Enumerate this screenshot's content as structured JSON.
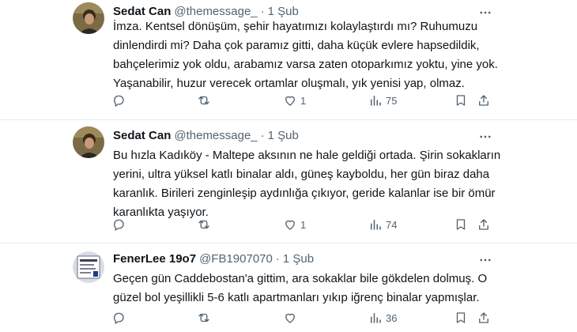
{
  "tweets": [
    {
      "name": "Sedat Can",
      "handle": "@themessage_",
      "separator": "·",
      "date": "1 Şub",
      "lines": [
        "İmza. Kentsel dönüşüm, şehir hayatımızı kolaylaştırdı mı? Ruhumuzu",
        "dinlendirdi mi? Daha çok paramız gitti, daha küçük evlere hapsedildik,",
        "bahçelerimiz yok oldu, arabamız varsa zaten otoparkımız yoktu, yine yok.",
        "Yaşanabilir, huzur verecek ortamlar oluşmalı, yık yenisi yap, olmaz."
      ],
      "replies": "",
      "retweets": "",
      "likes": "1",
      "views": "75"
    },
    {
      "name": "Sedat Can",
      "handle": "@themessage_",
      "separator": "·",
      "date": "1 Şub",
      "lines": [
        "Bu hızla Kadıköy - Maltepe aksının ne hale geldiği ortada. Şirin sokakların",
        "yerini, ultra yüksel katlı binalar aldı, güneş kayboldu, her gün biraz daha",
        "karanlık. Birileri zenginleşip aydınlığa çıkıyor, geride kalanlar ise bir ömür",
        "karanlıkta yaşıyor."
      ],
      "replies": "",
      "retweets": "",
      "likes": "1",
      "views": "74"
    },
    {
      "name": "FenerLee 19o7",
      "handle": "@FB1907070",
      "separator": "·",
      "date": "1 Şub",
      "lines": [
        "Geçen gün Caddebostan'a gittim, ara sokaklar bile gökdelen dolmuş. O",
        "güzel bol yeşillikli 5-6 katlı apartmanları yıkıp iğrenç binalar yapmışlar."
      ],
      "replies": "",
      "retweets": "",
      "likes": "",
      "views": "36"
    }
  ],
  "icons": {
    "reply": "reply-icon",
    "retweet": "retweet-icon",
    "like": "like-icon",
    "views": "views-icon",
    "bookmark": "bookmark-icon",
    "share": "share-icon",
    "more": "more-icon"
  },
  "colors": {
    "text": "#0f1419",
    "secondary": "#536471",
    "divider": "#e6ecf0"
  }
}
